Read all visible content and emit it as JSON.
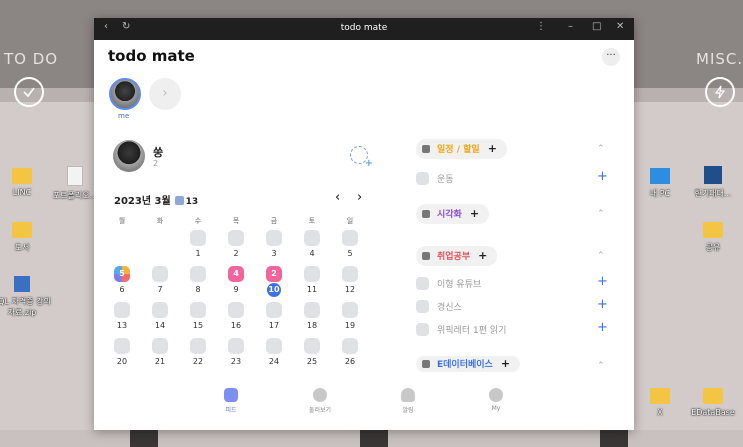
{
  "desktop": {
    "left_label": "TO DO",
    "right_label": "MISC.",
    "icons": [
      {
        "label": "LINC"
      },
      {
        "label": "포트폴리오..."
      },
      {
        "label": "도서"
      },
      {
        "label": "SQL 자격증 강의자료.zip"
      },
      {
        "label": "내 PC"
      },
      {
        "label": "한기대대..."
      },
      {
        "label": "공유"
      },
      {
        "label": "X"
      },
      {
        "label": "EDataBase"
      }
    ]
  },
  "window": {
    "title": "todo mate",
    "brand": "todo mate",
    "more": "···",
    "me_label": "me",
    "profile": {
      "name": "쑹",
      "count": "2"
    },
    "calendar": {
      "month_label": "2023년 3월",
      "done_count": "13",
      "weekdays": [
        "월",
        "화",
        "수",
        "목",
        "금",
        "토",
        "일"
      ],
      "weeks": [
        [
          "",
          "",
          "1",
          "2",
          "3",
          "4",
          "5"
        ],
        [
          "6",
          "7",
          "8",
          "9",
          "10",
          "11",
          "12"
        ],
        [
          "13",
          "14",
          "15",
          "16",
          "17",
          "18",
          "19"
        ],
        [
          "20",
          "21",
          "22",
          "23",
          "24",
          "25",
          "26"
        ]
      ],
      "badges": {
        "multi": "5",
        "pink_thu": "4",
        "pink_fri": "2"
      }
    },
    "categories": [
      {
        "name": "일정 / 할일",
        "color": "#f2a516",
        "todos": [
          "운동"
        ]
      },
      {
        "name": "시각화",
        "color": "#8a4fd8",
        "todos": []
      },
      {
        "name": "취업공부",
        "color": "#e0555b",
        "todos": [
          "이형 유튜브",
          "경신스",
          "위픽레터 1편 읽기"
        ]
      },
      {
        "name": "E데이터베이스",
        "color": "#3d72e4",
        "todos": []
      }
    ],
    "nav": [
      {
        "label": "피드"
      },
      {
        "label": "둘러보기"
      },
      {
        "label": "알림"
      },
      {
        "label": "My"
      }
    ]
  }
}
